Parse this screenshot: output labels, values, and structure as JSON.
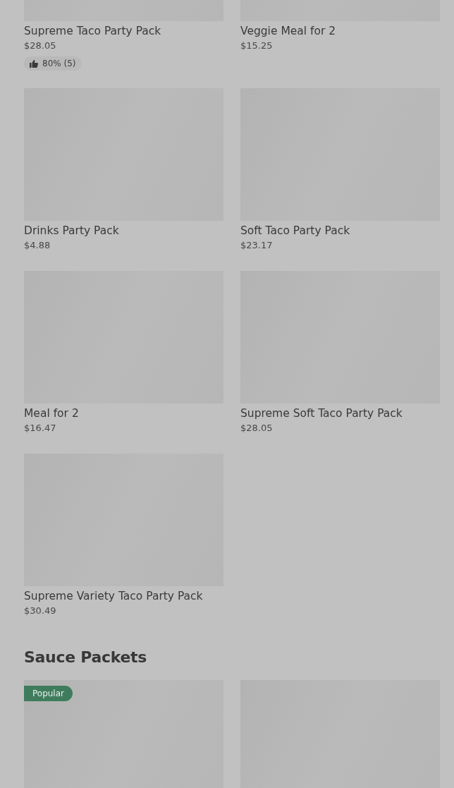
{
  "sections": [
    {
      "items": [
        {
          "name": "Supreme Taco Party Pack",
          "price": "$28.05",
          "rating": "80% (5)"
        },
        {
          "name": "Veggie Meal for 2",
          "price": "$15.25"
        },
        {
          "name": "Drinks Party Pack",
          "price": "$4.88"
        },
        {
          "name": "Soft Taco Party Pack",
          "price": "$23.17"
        },
        {
          "name": "Meal for 2",
          "price": "$16.47"
        },
        {
          "name": "Supreme Soft Taco Party Pack",
          "price": "$28.05"
        },
        {
          "name": "Supreme Variety Taco Party Pack",
          "price": "$30.49"
        }
      ]
    },
    {
      "title": "Sauce Packets",
      "items": [
        {
          "kind": "image",
          "badge": "Popular"
        },
        {
          "kind": "image"
        }
      ]
    }
  ]
}
